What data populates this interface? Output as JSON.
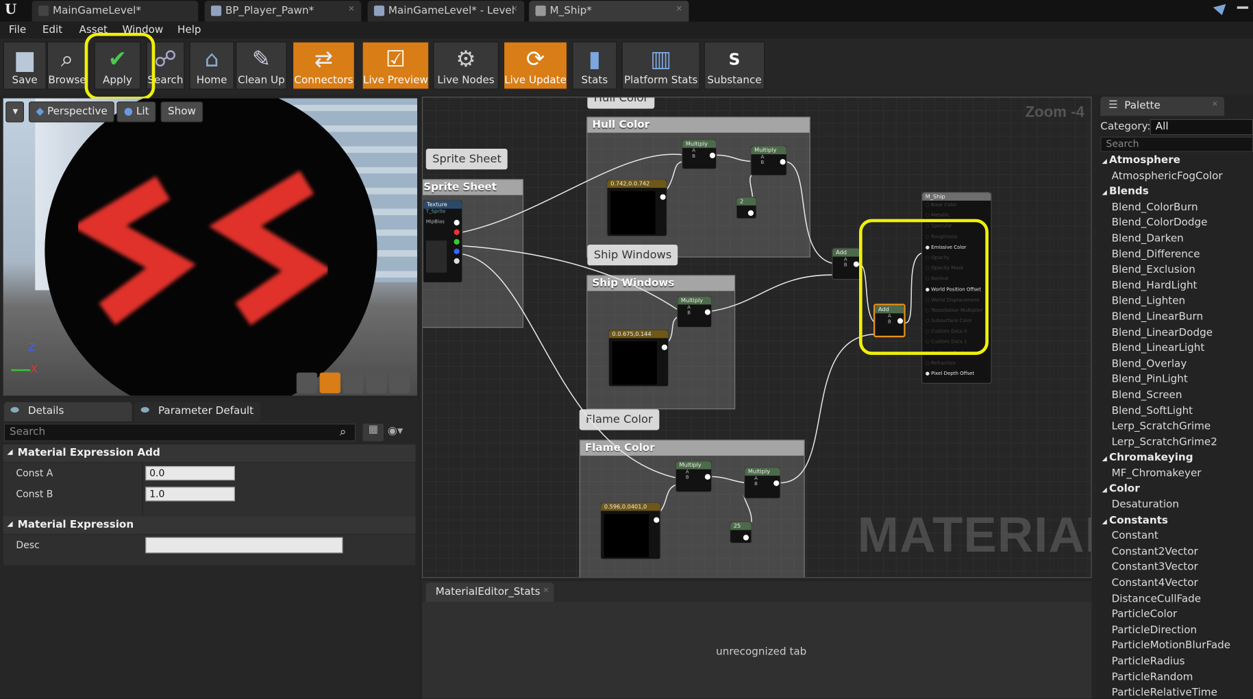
{
  "tabs": [
    "MainGameLevel*",
    "BP_Player_Pawn*",
    "MainGameLevel* - Level",
    "M_Ship*"
  ],
  "menu": [
    "File",
    "Edit",
    "Asset",
    "Window",
    "Help"
  ],
  "toolbar": {
    "buttons": [
      "Save",
      "Browse",
      "Apply",
      "Search",
      "Home",
      "Clean Up",
      "Connectors",
      "Live Preview",
      "Live Nodes",
      "Live Update",
      "Stats",
      "Platform Stats",
      "Substance"
    ]
  },
  "viewport": {
    "perspective": "Perspective",
    "lit": "Lit",
    "show": "Show",
    "axis_z": "Z",
    "axis_x": "X"
  },
  "details": {
    "tab_details": "Details",
    "tab_params": "Parameter Default",
    "search_placeholder": "Search",
    "section1": "Material Expression Add",
    "const_a_label": "Const A",
    "const_a_value": "0.0",
    "const_b_label": "Const B",
    "const_b_value": "1.0",
    "section2": "Material Expression",
    "desc_label": "Desc"
  },
  "graph": {
    "zoom": "Zoom -4",
    "watermark": "MATERIAL",
    "comments": {
      "hull_bubble_top": "Hull Color",
      "hull_head": "Hull Color",
      "sprite_bubble": "Sprite Sheet",
      "sprite_head": "Sprite Sheet",
      "ship_bubble": "Ship Windows",
      "ship_head": "Ship Windows",
      "flame_bubble": "Flame Color",
      "flame_head": "Flame Color"
    },
    "nodes": {
      "multiply": "Multiply",
      "add": "Add",
      "a": "A",
      "b": "B",
      "hull_const": "0.742,0.0.742",
      "ship_const": "0.0.675,0.144",
      "flame_const": "0.596,0.0401,0",
      "val2": "2",
      "val25": "25",
      "texture": "Texture",
      "tex_sub": "T_Sprite",
      "mipbias": "MipBias",
      "mship": "M_Ship",
      "mship_pins": [
        "Base Color",
        "Metallic",
        "Specular",
        "Roughness",
        "Emissive Color",
        "Opacity",
        "Opacity Mask",
        "Normal",
        "World Position Offset",
        "World Displacement",
        "Tessellation Multiplier",
        "Subsurface Color",
        "Custom Data 0",
        "Custom Data 1",
        "Ambient Occlusion",
        "Refraction",
        "Pixel Depth Offset"
      ]
    }
  },
  "stats": {
    "tab": "MaterialEditor_Stats",
    "message": "unrecognized tab"
  },
  "palette": {
    "title": "Palette",
    "category_label": "Category:",
    "category_value": "All",
    "search_placeholder": "Search",
    "groups": [
      {
        "name": "Atmosphere",
        "items": [
          "AtmosphericFogColor"
        ]
      },
      {
        "name": "Blends",
        "items": [
          "Blend_ColorBurn",
          "Blend_ColorDodge",
          "Blend_Darken",
          "Blend_Difference",
          "Blend_Exclusion",
          "Blend_HardLight",
          "Blend_Lighten",
          "Blend_LinearBurn",
          "Blend_LinearDodge",
          "Blend_LinearLight",
          "Blend_Overlay",
          "Blend_PinLight",
          "Blend_Screen",
          "Blend_SoftLight",
          "Lerp_ScratchGrime",
          "Lerp_ScratchGrime2"
        ]
      },
      {
        "name": "Chromakeying",
        "items": [
          "MF_Chromakeyer"
        ]
      },
      {
        "name": "Color",
        "items": [
          "Desaturation"
        ]
      },
      {
        "name": "Constants",
        "items": [
          "Constant",
          "Constant2Vector",
          "Constant3Vector",
          "Constant4Vector",
          "DistanceCullFade",
          "ParticleColor",
          "ParticleDirection",
          "ParticleMotionBlurFade",
          "ParticleRadius",
          "ParticleRandom",
          "ParticleRelativeTime"
        ]
      }
    ]
  },
  "colors": {
    "accent_orange": "#d97d16",
    "highlight_yellow": "#f0f00a",
    "emissive_red": "#e0302c"
  }
}
